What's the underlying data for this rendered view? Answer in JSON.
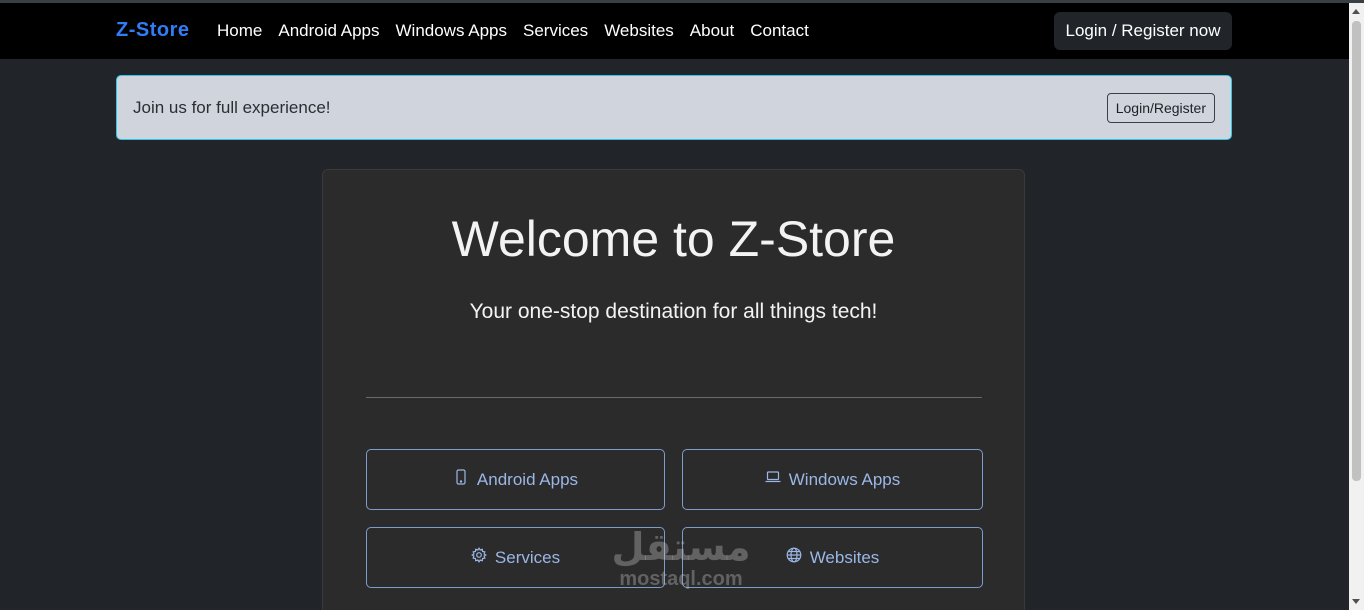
{
  "navbar": {
    "brand": "Z-Store",
    "links": [
      "Home",
      "Android Apps",
      "Windows Apps",
      "Services",
      "Websites",
      "About",
      "Contact"
    ],
    "login_button": "Login / Register now"
  },
  "alert": {
    "text": "Join us for full experience!",
    "button": "Login/Register"
  },
  "hero": {
    "title": "Welcome to Z-Store",
    "subtitle": "Your one-stop destination for all things tech!"
  },
  "categories": [
    {
      "label": "Android Apps",
      "icon": "phone-icon"
    },
    {
      "label": "Windows Apps",
      "icon": "laptop-icon"
    },
    {
      "label": "Services",
      "icon": "gear-icon"
    },
    {
      "label": "Websites",
      "icon": "globe-icon"
    }
  ],
  "watermark": {
    "arabic": "مستقل",
    "latin": "mostaql.com"
  },
  "colors": {
    "brand": "#2f7ef7",
    "accent_button": "#9ab7e6",
    "alert_border": "#2cc9e6"
  }
}
